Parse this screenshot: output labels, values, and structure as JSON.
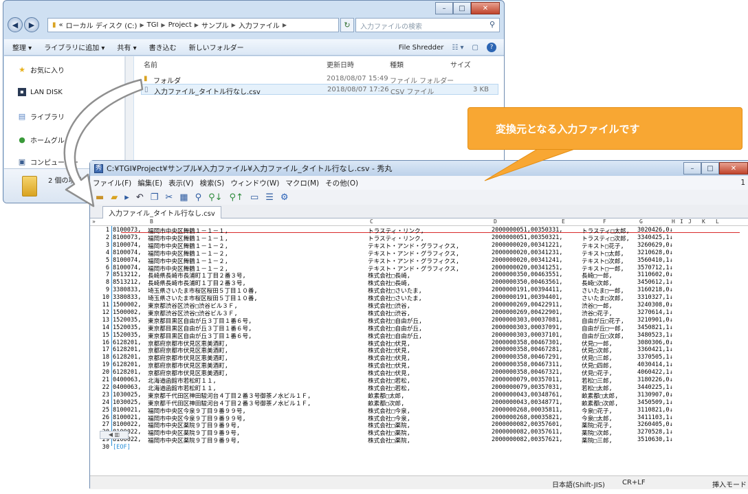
{
  "explorer": {
    "address_segments": [
      "«",
      "ローカル ディスク (C:)",
      "TGI",
      "Project",
      "サンプル",
      "入力ファイル"
    ],
    "search_placeholder": "入力ファイルの検索",
    "toolbar": [
      "整理 ▾",
      "ライブラリに追加 ▾",
      "共有 ▾",
      "書き込む",
      "新しいフォルダー"
    ],
    "toolbar_right": "File Shredder",
    "nav": [
      {
        "label": "お気に入り",
        "icon": "star-icon"
      },
      {
        "label": "LAN DISK",
        "icon": "drive-icon"
      },
      {
        "label": "ライブラリ",
        "icon": "library-icon"
      },
      {
        "label": "ホームグループ",
        "icon": "homegroup-icon"
      },
      {
        "label": "コンピューター",
        "icon": "computer-icon"
      }
    ],
    "columns": {
      "name": "名前",
      "date": "更新日時",
      "type": "種類",
      "size": "サイズ"
    },
    "files": [
      {
        "name": "フォルダ",
        "date": "2018/08/07 15:49",
        "type": "ファイル フォルダー",
        "size": ""
      },
      {
        "name": "入力ファイル_タイトル行なし.csv",
        "date": "2018/08/07 17:26",
        "type": "CSV ファイル",
        "size": "3 KB"
      }
    ],
    "status": "2 個の項目"
  },
  "editor": {
    "title": "C:¥TGI¥Project¥サンプル¥入力ファイル¥入力ファイル_タイトル行なし.csv - 秀丸",
    "menu": [
      "ファイル(F)",
      "編集(E)",
      "表示(V)",
      "検索(S)",
      "ウィンドウ(W)",
      "マクロ(M)",
      "その他(O)"
    ],
    "menu_right": "1",
    "tab": "入力ファイル_タイトル行なし.csv",
    "ruler": [
      "B",
      "C",
      "D",
      "E",
      "F",
      "G",
      "H",
      "I",
      "J",
      "K",
      "L"
    ],
    "lines": [
      [
        "8100073",
        "福岡市中央区舞鶴１－１－１,",
        "トラスティ・リンク,",
        "2000000051,00350331,",
        "トラスティ□太郎,",
        "3020426,0↓"
      ],
      [
        "8100073",
        "福岡市中央区舞鶴１－１－１,",
        "トラスティ・リンク,",
        "2000000051,00350321,",
        "トラスティ□次郎,",
        "3340425,1↓"
      ],
      [
        "8100074",
        "福岡市中央区舞鶴１－１－２,",
        "テキスト・アンド・グラフィクス,",
        "2000000020,00341221,",
        "テキスト□花子,",
        "3260629,0↓"
      ],
      [
        "8100074",
        "福岡市中央区舞鶴１－１－２,",
        "テキスト・アンド・グラフィクス,",
        "2000000020,00341231,",
        "テキスト□太郎,",
        "3210628,0↓"
      ],
      [
        "8100074",
        "福岡市中央区舞鶴１－１－２,",
        "テキスト・アンド・グラフィクス,",
        "2000000020,00341241,",
        "テキスト□次郎,",
        "3560410,1↓"
      ],
      [
        "8100074",
        "福岡市中央区舞鶴１－１－２,",
        "テキスト・アンド・グラフィクス,",
        "2000000020,00341251,",
        "テキスト□一郎,",
        "3570712,1↓"
      ],
      [
        "8513212",
        "長崎県長崎市長浦町１丁目２番３号,",
        "株式会社□長崎,",
        "2000000350,00463551,",
        "長崎□一郎,",
        "3110602,0↓"
      ],
      [
        "8513212",
        "長崎県長崎市長浦町１丁目２番３号,",
        "株式会社□長崎,",
        "2000000350,00463561,",
        "長崎□次郎,",
        "3450612,1↓"
      ],
      [
        "3380833",
        "埼玉県さいたま市桜区桜田５丁目１０番,",
        "株式会社□さいたま,",
        "2000000191,00394411,",
        "さいたま□一郎,",
        "3160218,0↓"
      ],
      [
        "3380833",
        "埼玉県さいたま市桜区桜田５丁目１０番,",
        "株式会社□さいたま,",
        "2000000191,00394401,",
        "さいたま□次郎,",
        "3310327,1↓"
      ],
      [
        "1500002",
        "東京都渋谷区渋谷□渋谷ビル３Ｆ,",
        "株式会社□渋谷,",
        "2000000269,00422911,",
        "渋谷□一郎,",
        "3240308,0↓"
      ],
      [
        "1500002",
        "東京都渋谷区渋谷□渋谷ビル３Ｆ,",
        "株式会社□渋谷,",
        "2000000269,00422901,",
        "渋谷□花子,",
        "3270614,1↓"
      ],
      [
        "1520035",
        "東京都目黒区自由が丘３丁目１番６号,",
        "株式会社□自由が丘,",
        "2000000303,00037081,",
        "自由が丘□花子,",
        "3210901,0↓"
      ],
      [
        "1520035",
        "東京都目黒区自由が丘３丁目１番６号,",
        "株式会社□自由が丘,",
        "2000000303,00037091,",
        "自由が丘□一郎,",
        "3450821,1↓"
      ],
      [
        "1520035",
        "東京都目黒区自由が丘３丁目１番６号,",
        "株式会社□自由が丘,",
        "2000000303,00037101,",
        "自由が丘□次郎,",
        "3480523,1↓"
      ],
      [
        "6128201",
        "京都府京都市伏見区恵美酒町,",
        "株式会社□伏見,",
        "2000000358,00467301,",
        "伏見□一郎,",
        "3080306,0↓"
      ],
      [
        "6128201",
        "京都府京都市伏見区恵美酒町,",
        "株式会社□伏見,",
        "2000000358,00467281,",
        "伏見□次郎,",
        "3360421,1↓"
      ],
      [
        "6128201",
        "京都府京都市伏見区恵美酒町,",
        "株式会社□伏見,",
        "2000000358,00467291,",
        "伏見□三郎,",
        "3370505,1↓"
      ],
      [
        "6128201",
        "京都府京都市伏見区恵美酒町,",
        "株式会社□伏見,",
        "2000000358,00467311,",
        "伏見□四郎,",
        "4030414,1↓"
      ],
      [
        "6128201",
        "京都府京都市伏見区恵美酒町,",
        "株式会社□伏見,",
        "2000000358,00467321,",
        "伏見□花子,",
        "4060422,1↓"
      ],
      [
        "0400063",
        "北海道函館市若松町１１,",
        "株式会社□若松,",
        "2000000079,00357011,",
        "若松□三郎,",
        "3180226,0↓"
      ],
      [
        "0400063",
        "北海道函館市若松町１１,",
        "株式会社□若松,",
        "2000000079,00357031,",
        "若松□太郎,",
        "3440225,1↓"
      ],
      [
        "1030025",
        "東京都千代田区神田駿河台４丁目２番３号御茶ノ水ビル１Ｆ,",
        "畝素都□太郎,",
        "2000000043,00348761,",
        "畝素都□太郎,",
        "3130907,0↓"
      ],
      [
        "1030025",
        "東京都千代田区神田駿河台４丁目２番３号御茶ノ水ビル１Ｆ,",
        "畝素都□次郎,",
        "2000000043,00348771,",
        "畝素都□次郎,",
        "3450509,1↓"
      ],
      [
        "8100021",
        "福岡市中央区今泉９丁目９番９９号,",
        "株式会社□今泉,",
        "2000000268,00035811,",
        "今泉□花子,",
        "3110821,0↓"
      ],
      [
        "8100021",
        "福岡市中央区今泉９丁目９番９９号,",
        "株式会社□今泉,",
        "2000000268,00035821,",
        "今泉□太郎,",
        "3411103,1↓"
      ],
      [
        "8100022",
        "福岡市中央区薬院９丁目９番９号,",
        "株式会社□薬院,",
        "2000000082,00357601,",
        "薬院□花子,",
        "3260405,0↓"
      ],
      [
        "8100022",
        "福岡市中央区薬院９丁目９番９号,",
        "株式会社□薬院,",
        "2000000082,00357611,",
        "薬院□次郎,",
        "3270528,1↓"
      ],
      [
        "8100022",
        "福岡市中央区薬院９丁目９番９号,",
        "株式会社□薬院,",
        "2000000082,00357621,",
        "薬院□三郎,",
        "3510630,1↓"
      ]
    ],
    "eof_line_number": "30",
    "eof_text": "[EOF]",
    "status": {
      "encoding": "日本語(Shift-JIS)",
      "newline": "CR+LF",
      "mode": "挿入モード"
    }
  },
  "callout": {
    "text": "変換元となる入力ファイルです",
    "color": "#f8a733"
  }
}
